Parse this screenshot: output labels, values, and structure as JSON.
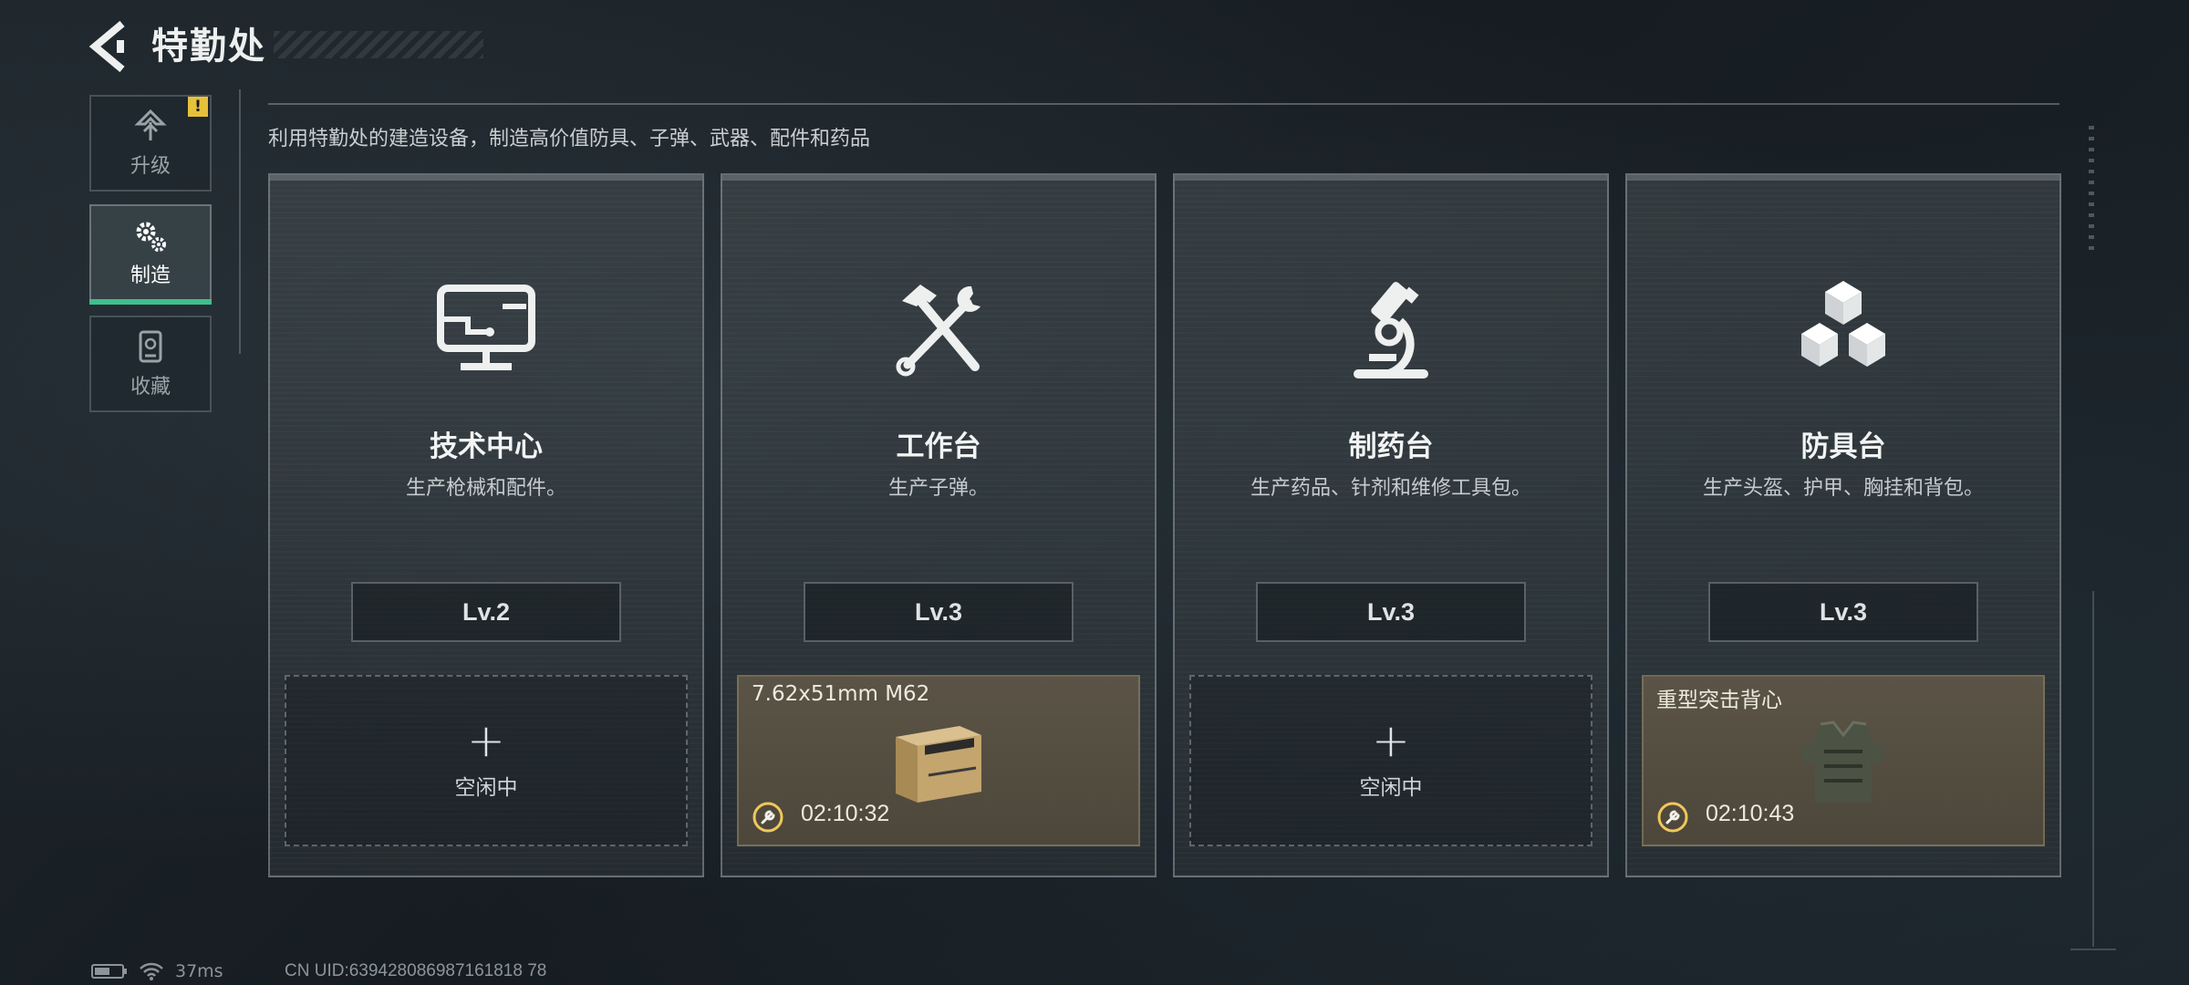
{
  "header": {
    "title": "特勤处"
  },
  "sidebar": {
    "items": [
      {
        "label": "升级",
        "icon": "upgrade-icon",
        "warning": "!"
      },
      {
        "label": "制造",
        "icon": "gear-icon",
        "active": true
      },
      {
        "label": "收藏",
        "icon": "collection-icon"
      }
    ]
  },
  "description": "利用特勤处的建造设备，制造高价值防具、子弹、武器、配件和药品",
  "stations": [
    {
      "name": "技术中心",
      "subtitle": "生产枪械和配件。",
      "level": "Lv.2",
      "icon": "computer-icon",
      "slot": {
        "state": "idle",
        "plus": "+",
        "label": "空闲中"
      }
    },
    {
      "name": "工作台",
      "subtitle": "生产子弹。",
      "level": "Lv.3",
      "icon": "hammer-wrench-icon",
      "slot": {
        "state": "busy",
        "item": "7.62x51mm M62",
        "timer": "02:10:32",
        "item_icon": "ammo-box-icon"
      }
    },
    {
      "name": "制药台",
      "subtitle": "生产药品、针剂和维修工具包。",
      "level": "Lv.3",
      "icon": "microscope-icon",
      "slot": {
        "state": "idle",
        "plus": "+",
        "label": "空闲中"
      }
    },
    {
      "name": "防具台",
      "subtitle": "生产头盔、护甲、胸挂和背包。",
      "level": "Lv.3",
      "icon": "cubes-icon",
      "slot": {
        "state": "busy",
        "item": "重型突击背心",
        "timer": "02:10:43",
        "item_icon": "armor-vest-icon"
      }
    }
  ],
  "footer": {
    "ping": "37ms",
    "uid": "CN UID:639428086987161818 78"
  },
  "colors": {
    "accent": "#3fbf8d",
    "warning": "#e6c23a",
    "busy_slot": "#5b5446"
  }
}
